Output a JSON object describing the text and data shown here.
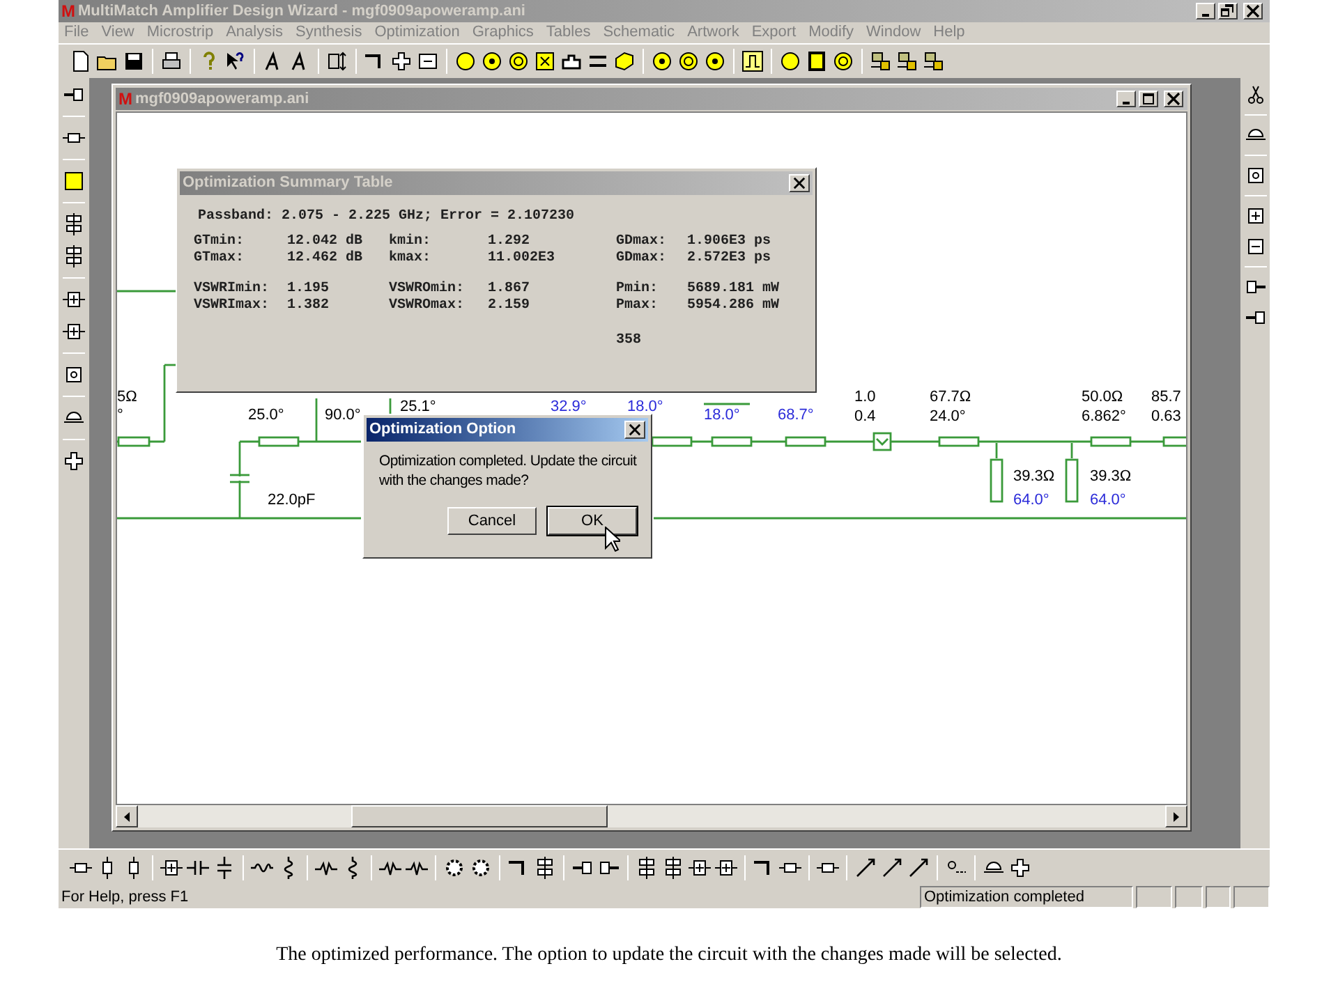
{
  "window": {
    "logo": "M",
    "title": "MultiMatch Amplifier Design Wizard - mgf0909apoweramp.ani"
  },
  "menu": [
    "File",
    "View",
    "Microstrip",
    "Analysis",
    "Synthesis",
    "Optimization",
    "Graphics",
    "Tables",
    "Schematic",
    "Artwork",
    "Export",
    "Modify",
    "Window",
    "Help"
  ],
  "document": {
    "logo": "M",
    "title": "mgf0909apoweramp.ani"
  },
  "circuit_labels": [
    {
      "text": "5Ω",
      "color": "#000000"
    },
    {
      "text": "°",
      "color": "#000000"
    },
    {
      "text": "25.0°",
      "color": "#000000"
    },
    {
      "text": "90.0°",
      "color": "#000000"
    },
    {
      "text": "25.1°",
      "color": "#000000"
    },
    {
      "text": "32.9°",
      "color": "#2b2bd9"
    },
    {
      "text": "18.0°",
      "color": "#2b2bd9"
    },
    {
      "text": "18.0°",
      "color": "#2b2bd9"
    },
    {
      "text": "68.7°",
      "color": "#2b2bd9"
    },
    {
      "text": "1.0",
      "color": "#000000"
    },
    {
      "text": "0.4",
      "color": "#000000"
    },
    {
      "text": "67.7Ω",
      "color": "#000000"
    },
    {
      "text": "24.0°",
      "color": "#000000"
    },
    {
      "text": "50.0Ω",
      "color": "#000000"
    },
    {
      "text": "6.862°",
      "color": "#000000"
    },
    {
      "text": "85.7",
      "color": "#000000"
    },
    {
      "text": "0.63",
      "color": "#000000"
    },
    {
      "text": "39.3Ω",
      "color": "#000000"
    },
    {
      "text": "39.3Ω",
      "color": "#000000"
    },
    {
      "text": "22.0pF",
      "color": "#000000"
    },
    {
      "text": "64.0°",
      "color": "#2b2bd9"
    },
    {
      "text": "64.0°",
      "color": "#2b2bd9"
    }
  ],
  "summary_dialog": {
    "title": "Optimization Summary Table",
    "passband": "Passband: 2.075 - 2.225 GHz; Error = 2.107230",
    "groups": [
      [
        [
          "GTmin:",
          "12.042 dB",
          "kmin:",
          "1.292",
          "GDmax:",
          "1.906E3 ps"
        ],
        [
          "GTmax:",
          "12.462 dB",
          "kmax:",
          "11.002E3",
          "GDmax:",
          "2.572E3 ps"
        ]
      ],
      [
        [
          "VSWRImin:",
          "1.195",
          "VSWROmin:",
          "1.867",
          "Pmin:",
          "5689.181 mW"
        ],
        [
          "VSWRImax:",
          "1.382",
          "VSWROmax:",
          "2.159",
          "Pmax:",
          "5954.286 mW"
        ]
      ]
    ],
    "footer": "358"
  },
  "option_dialog": {
    "title": "Optimization Option",
    "message_lines": [
      "Optimization completed. Update the circuit",
      "with the changes made?"
    ],
    "buttons": [
      {
        "label": "Cancel",
        "default": false
      },
      {
        "label": "OK",
        "default": true
      }
    ]
  },
  "status_bar": {
    "help": "For Help, press F1",
    "panels": [
      "Optimization completed"
    ]
  },
  "caption": "The optimized performance. The option to update the circuit with the changes made will be selected."
}
